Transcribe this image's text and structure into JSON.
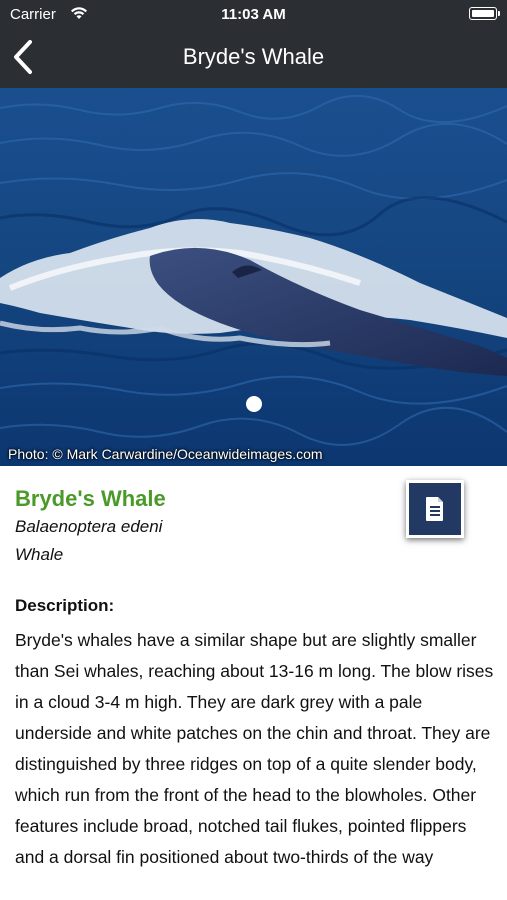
{
  "status_bar": {
    "carrier": "Carrier",
    "time": "11:03 AM"
  },
  "nav": {
    "title": "Bryde's Whale",
    "back_icon": "chevron-left-icon"
  },
  "hero": {
    "photo_credit": "Photo: © Mark Carwardine/Oceanwideimages.com",
    "page_indicator": {
      "current": 1,
      "total": 1
    }
  },
  "species": {
    "common_name": "Bryde's Whale",
    "scientific_name": "Balaenoptera edeni",
    "category": "Whale"
  },
  "document_button": {
    "icon": "document-icon",
    "bg_color": "#223a63"
  },
  "description": {
    "heading": "Description:",
    "text": "Bryde's whales have a similar shape but are slightly smaller than Sei whales, reaching about 13-16 m long. The blow rises in a cloud 3-4 m high. They are dark grey with a pale underside and white patches on the chin and throat. They are distinguished by three ridges on top of a quite slender body, which run from the front of the head to the blowholes. Other features include broad, notched tail flukes, pointed flippers and a dorsal fin positioned about two-thirds of the way"
  },
  "colors": {
    "header_bg": "#2b2f33",
    "name_green": "#4a9a2a"
  }
}
